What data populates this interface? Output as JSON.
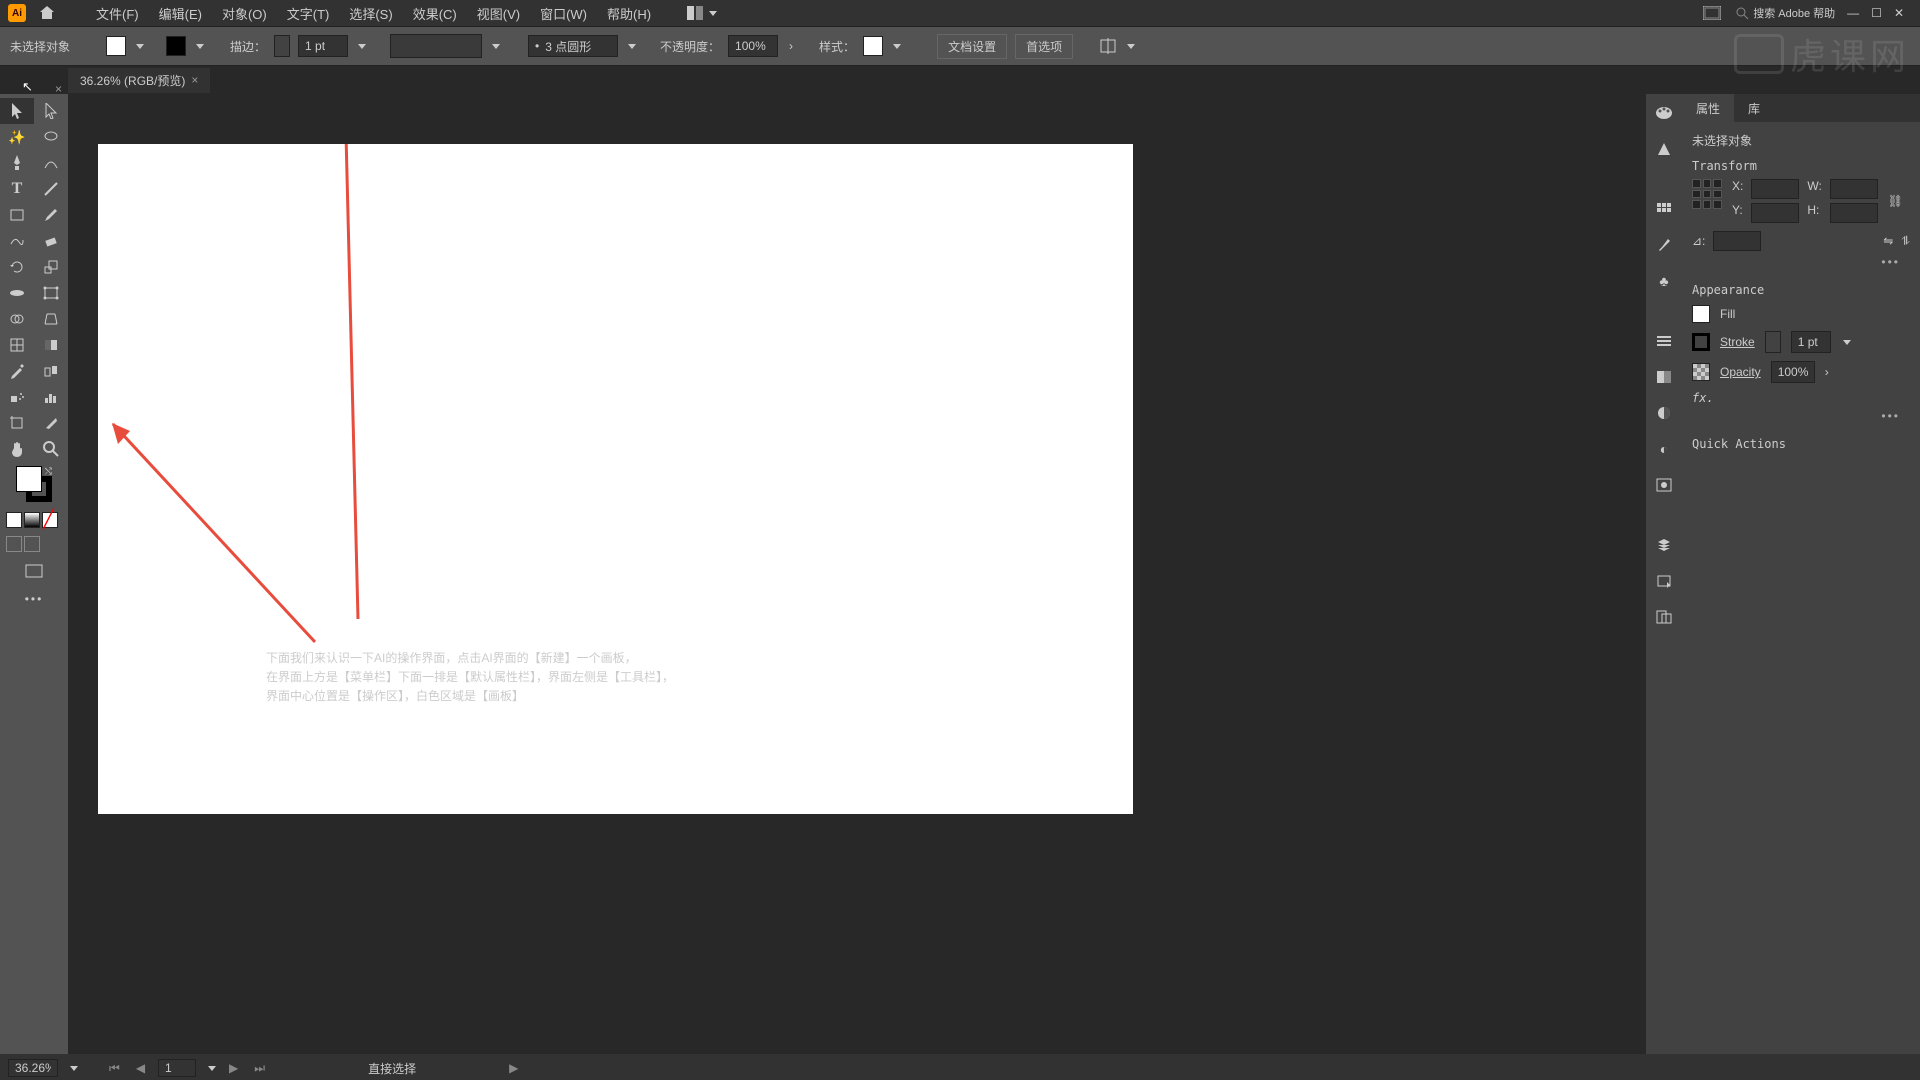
{
  "menubar": {
    "items": [
      "文件(F)",
      "编辑(E)",
      "对象(O)",
      "文字(T)",
      "选择(S)",
      "效果(C)",
      "视图(V)",
      "窗口(W)",
      "帮助(H)"
    ],
    "search_placeholder": "搜索 Adobe 帮助"
  },
  "controlbar": {
    "no_selection": "未选择对象",
    "stroke_label": "描边：",
    "stroke_value": "1 pt",
    "brush_value": "3 点圆形",
    "opacity_label": "不透明度：",
    "opacity_value": "100%",
    "style_label": "样式：",
    "doc_setup": "文档设置",
    "prefs": "首选项"
  },
  "doc_tab": {
    "title": "36.26% (RGB/预览)"
  },
  "annotation": {
    "line1": "下面我们来认识一下AI的操作界面，点击AI界面的【新建】一个画板，",
    "line2": "在界面上方是【菜单栏】下面一排是【默认属性栏】，界面左侧是【工具栏】，",
    "line3": "界面中心位置是【操作区】，白色区域是【画板】"
  },
  "props": {
    "tab_props": "属性",
    "tab_lib": "库",
    "no_selection": "未选择对象",
    "transform_title": "Transform",
    "x_label": "X:",
    "y_label": "Y:",
    "w_label": "W:",
    "h_label": "H:",
    "angle_label": "⊿:",
    "appearance_title": "Appearance",
    "fill_label": "Fill",
    "stroke_label": "Stroke",
    "stroke_value": "1 pt",
    "opacity_label": "Opacity",
    "opacity_value": "100%",
    "fx_label": "fx.",
    "quick_actions": "Quick Actions"
  },
  "status": {
    "zoom": "36.26%",
    "artboard_num": "1",
    "tool_hint": "直接选择"
  },
  "watermark": "虎课网"
}
